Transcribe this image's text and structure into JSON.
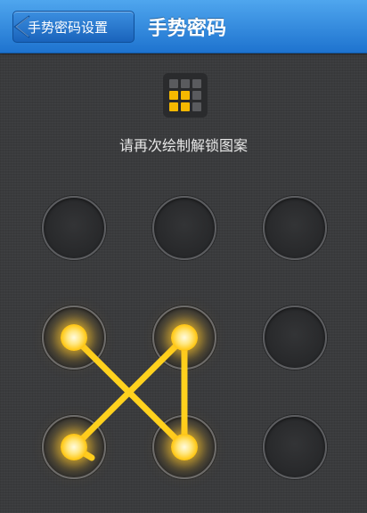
{
  "nav": {
    "back_label": "手势密码设置",
    "title": "手势密码"
  },
  "instruction": "请再次绘制解锁图案",
  "preview_icon": "pattern-grid-icon",
  "pattern": {
    "selected_nodes": [
      4,
      5,
      7,
      8
    ],
    "draw_order": [
      4,
      8,
      5,
      7
    ]
  },
  "colors": {
    "nav_blue": "#2a86e0",
    "active_yellow": "#ffd21e",
    "inactive_node": "#5c5d60"
  }
}
